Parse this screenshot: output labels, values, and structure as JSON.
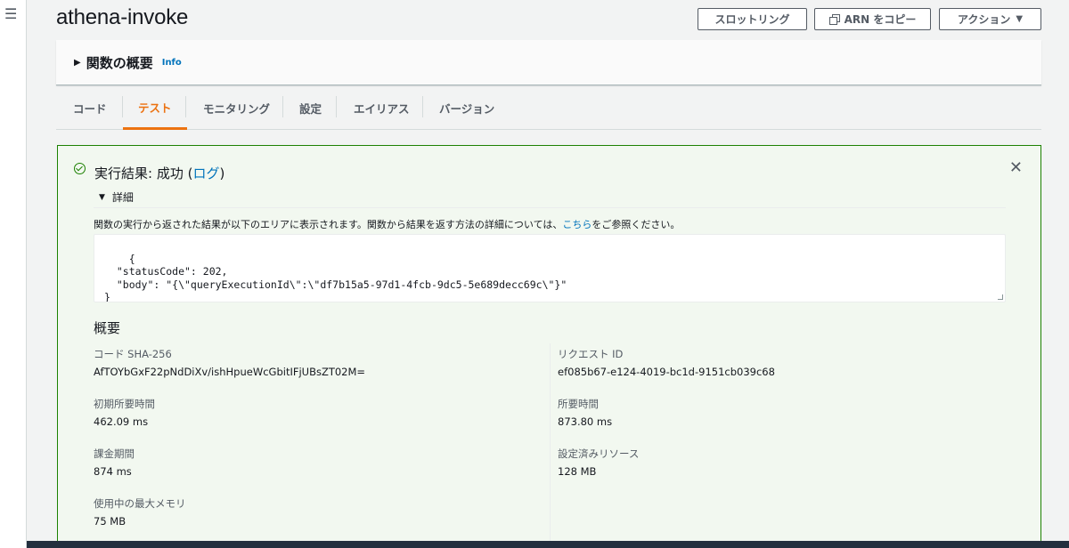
{
  "window": {
    "menu_icon": "hamburger-menu-icon"
  },
  "header": {
    "title": "athena-invoke",
    "buttons": {
      "throttle": "スロットリング",
      "copy_arn": "ARN をコピー",
      "actions": "アクション"
    }
  },
  "overview": {
    "title": "関数の概要",
    "info": "Info"
  },
  "tabs": [
    "コード",
    "テスト",
    "モニタリング",
    "設定",
    "エイリアス",
    "バージョン"
  ],
  "active_tab": "テスト",
  "result": {
    "title_prefix": "実行結果: 成功 (",
    "title_link": "ログ",
    "title_suffix": ")",
    "details_label": "詳細",
    "description_prefix": "関数の実行から返された結果が以下のエリアに表示されます。関数から結果を返す方法の詳細については、",
    "description_link": "こちら",
    "description_suffix": "をご参照ください。",
    "output": "{\n  \"statusCode\": 202,\n  \"body\": \"{\\\"queryExecutionId\\\":\\\"df7b15a5-97d1-4fcb-9dc5-5e689decc69c\\\"}\"\n}",
    "summary": {
      "title": "概要",
      "code_sha_label": "コード SHA-256",
      "code_sha_value": "AfTOYbGxF22pNdDiXv/ishHpueWcGbitIFjUBsZT02M=",
      "request_id_label": "リクエスト ID",
      "request_id_value": "ef085b67-e124-4019-bc1d-9151cb039c68",
      "init_duration_label": "初期所要時間",
      "init_duration_value": "462.09 ms",
      "duration_label": "所要時間",
      "duration_value": "873.80 ms",
      "billed_duration_label": "課金期間",
      "billed_duration_value": "874 ms",
      "resources_label": "設定済みリソース",
      "resources_value": "128 MB",
      "max_memory_label": "使用中の最大メモリ",
      "max_memory_value": "75 MB"
    }
  },
  "colors": {
    "accent": "#ec7211",
    "link": "#0073bb",
    "success": "#1d8102",
    "success_bg": "#f2f8f0"
  }
}
